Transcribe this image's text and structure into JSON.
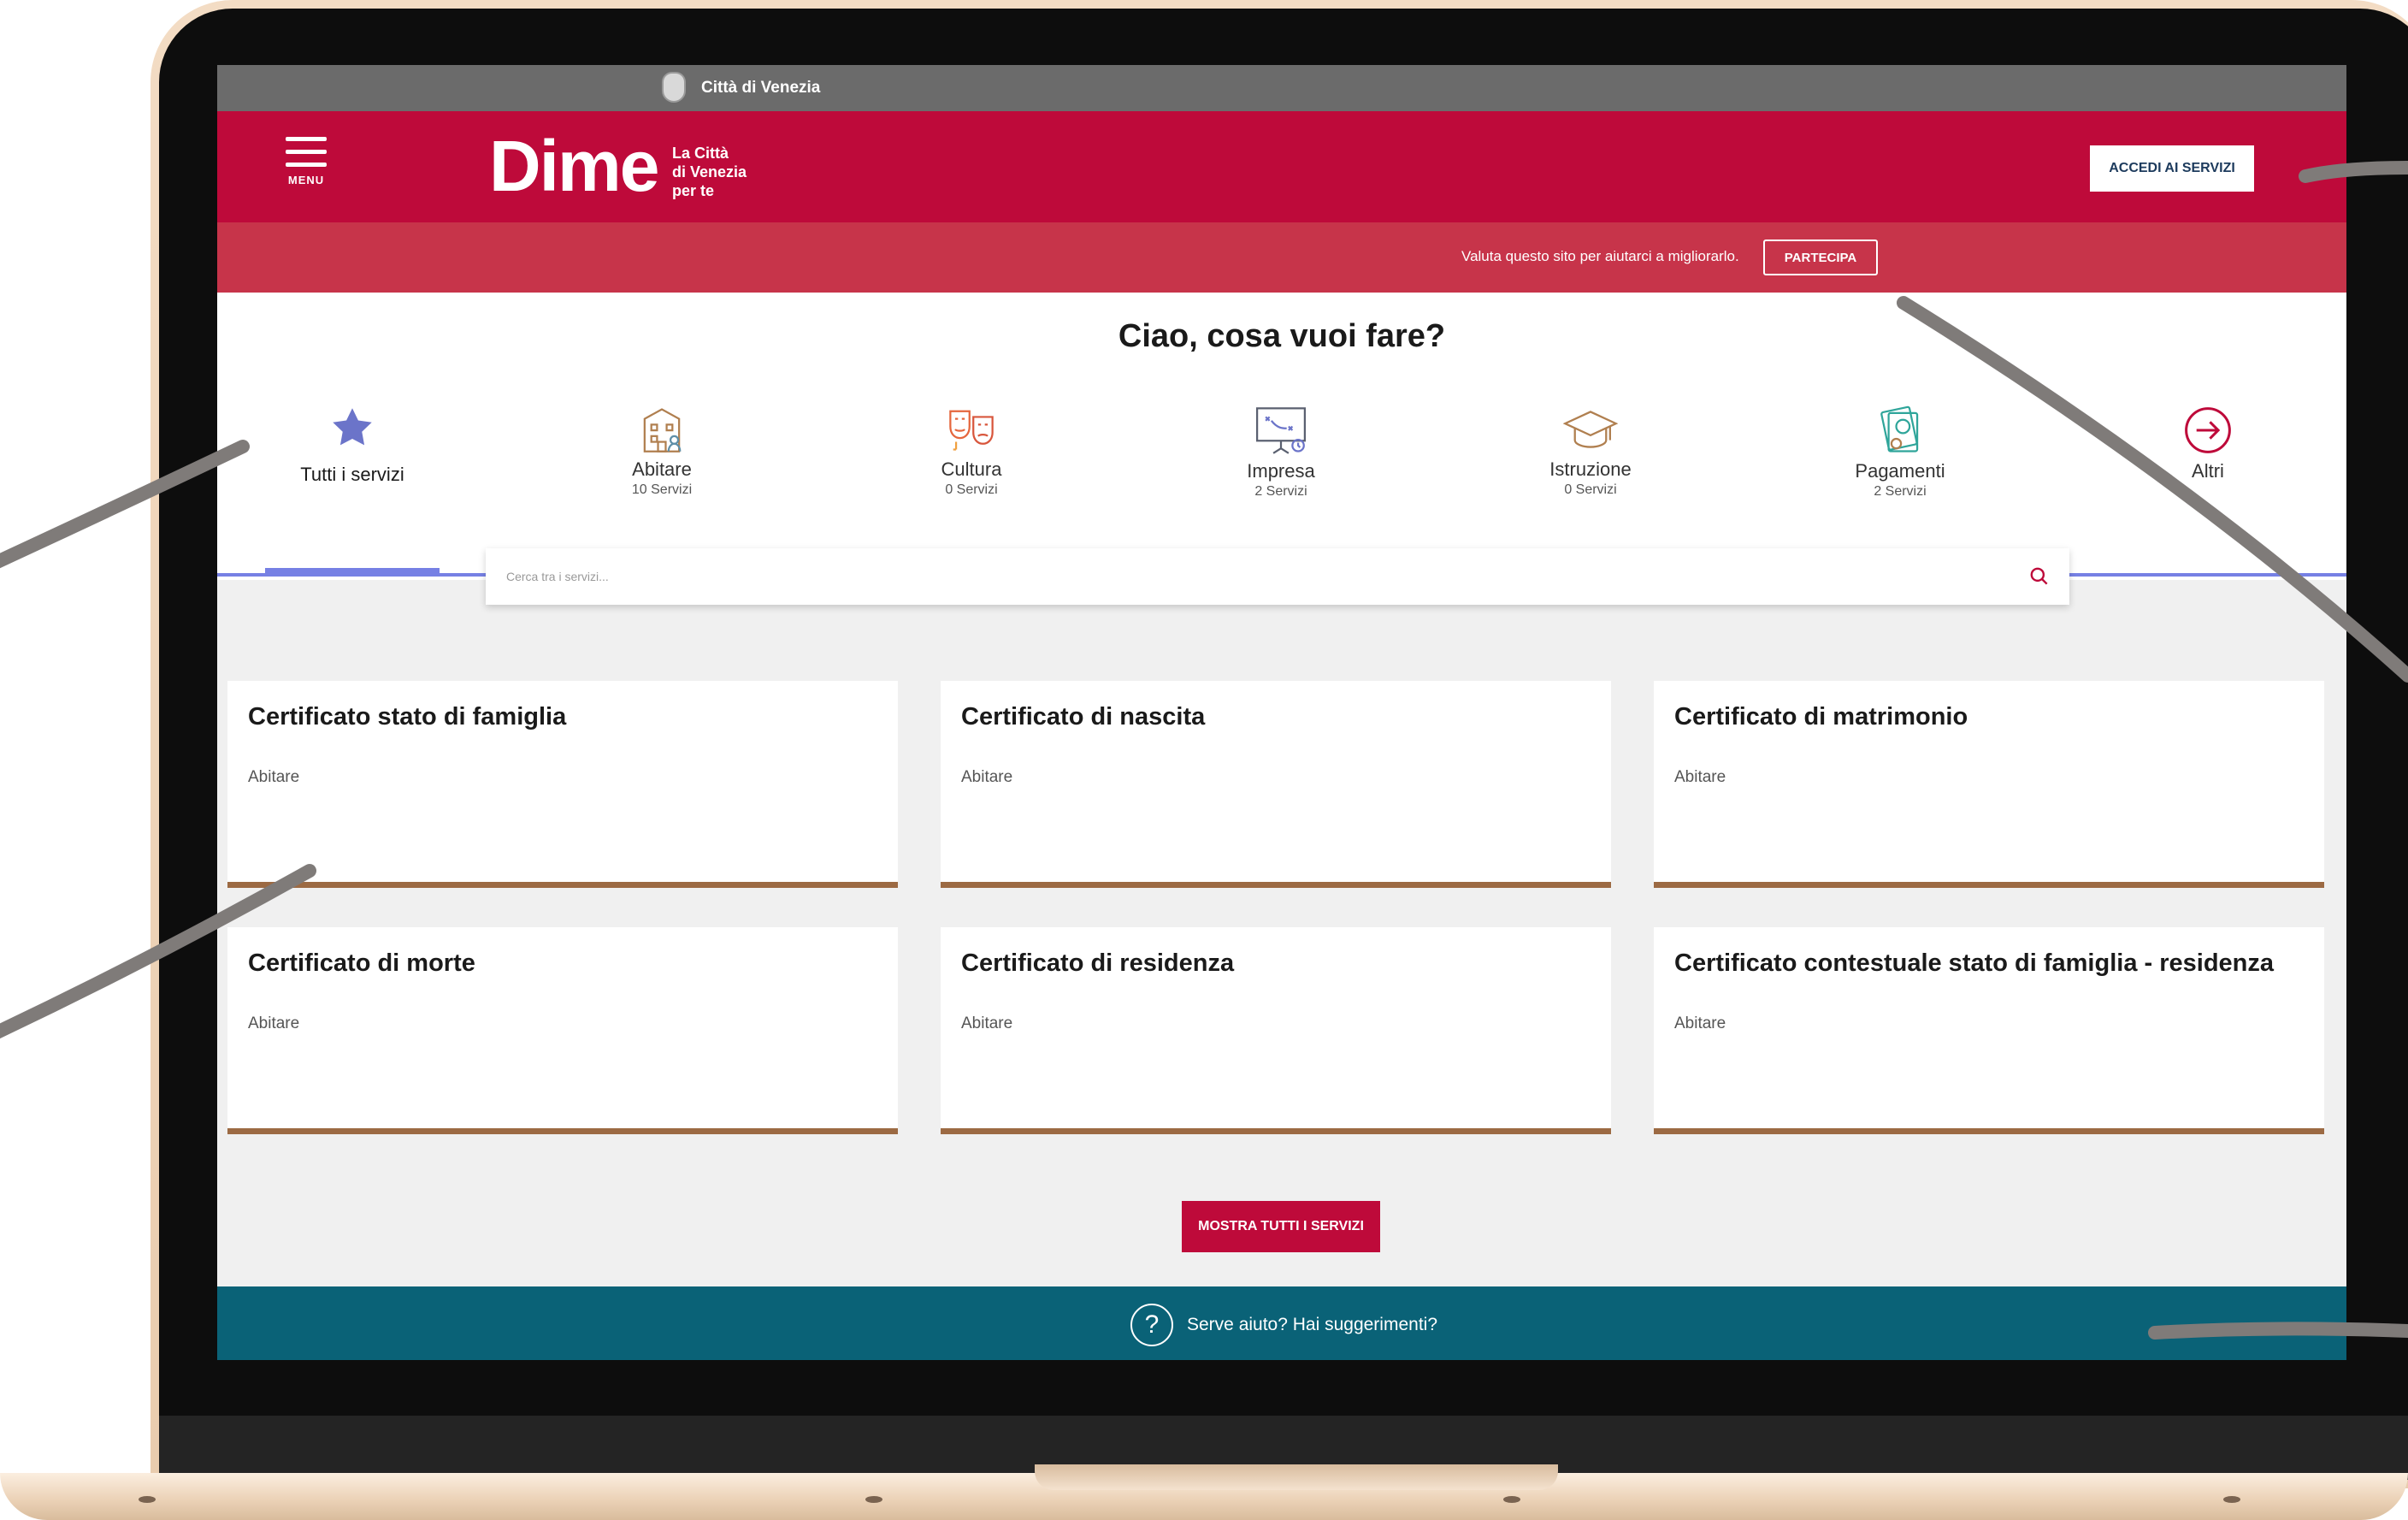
{
  "slim_header": {
    "city_name": "Città di Venezia"
  },
  "header": {
    "menu_label": "MENU",
    "logo_word": "Dime",
    "logo_tagline": [
      "La Città",
      "di Venezia",
      "per te"
    ],
    "login_button": "ACCEDI AI SERVIZI"
  },
  "feedback": {
    "message": "Valuta questo sito per aiutarci a migliorarlo.",
    "button": "PARTECIPA"
  },
  "main": {
    "greeting": "Ciao, cosa vuoi fare?"
  },
  "categories": [
    {
      "name": "Tutti i servizi",
      "count": "",
      "icon": "star-icon",
      "active": true
    },
    {
      "name": "Abitare",
      "count": "10 Servizi",
      "icon": "building-icon"
    },
    {
      "name": "Cultura",
      "count": "0 Servizi",
      "icon": "theater-masks-icon"
    },
    {
      "name": "Impresa",
      "count": "2 Servizi",
      "icon": "strategy-board-icon"
    },
    {
      "name": "Istruzione",
      "count": "0 Servizi",
      "icon": "graduation-cap-icon"
    },
    {
      "name": "Pagamenti",
      "count": "2 Servizi",
      "icon": "money-icon"
    },
    {
      "name": "Altri",
      "count": "",
      "icon": "arrow-right-circle-icon"
    }
  ],
  "search": {
    "placeholder": "Cerca tra i servizi...",
    "value": ""
  },
  "services": [
    {
      "title": "Certificato stato di famiglia",
      "category": "Abitare"
    },
    {
      "title": "Certificato di nascita",
      "category": "Abitare"
    },
    {
      "title": "Certificato di matrimonio",
      "category": "Abitare"
    },
    {
      "title": "Certificato di morte",
      "category": "Abitare"
    },
    {
      "title": "Certificato di residenza",
      "category": "Abitare"
    },
    {
      "title": "Certificato contestuale stato di famiglia - residenza",
      "category": "Abitare"
    }
  ],
  "show_all_button": "MOSTRA TUTTI I SERVIZI",
  "help": {
    "text": "Serve aiuto? Hai suggerimenti?",
    "icon_glyph": "?"
  },
  "colors": {
    "brand_red": "#be0a3a",
    "feedback_red": "#c7344a",
    "slim_gray": "#6b6b6b",
    "accent_blue": "#7680e4",
    "card_border_brown": "#9c6a43",
    "help_teal": "#0a6277",
    "laptop_gold": "#ecd3b8"
  }
}
